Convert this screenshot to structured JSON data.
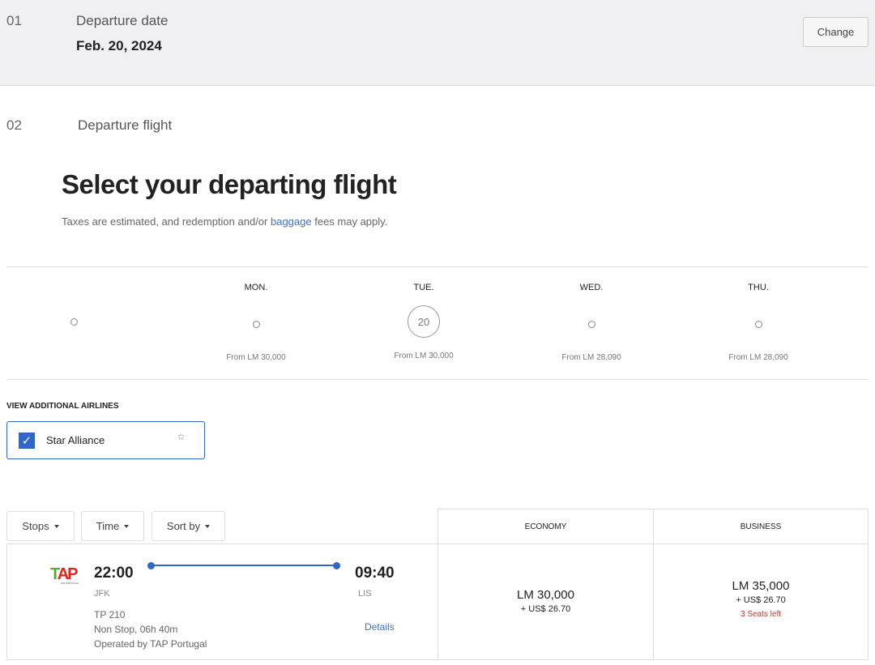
{
  "step1": {
    "num": "01",
    "label": "Departure date",
    "date": "Feb. 20, 2024",
    "change": "Change"
  },
  "step2": {
    "num": "02",
    "label": "Departure flight"
  },
  "title": "Select your departing flight",
  "subtitle": {
    "before": "Taxes are estimated, and redemption and/or ",
    "link": "baggage",
    "after": " fees may apply."
  },
  "days": [
    {
      "name": "MON.",
      "from": "From LM 30,000"
    },
    {
      "name": "TUE.",
      "date": "20",
      "from": "From LM 30,000",
      "selected": true
    },
    {
      "name": "WED.",
      "from": "From LM 28,090"
    },
    {
      "name": "THU.",
      "from": "From LM 28,090"
    }
  ],
  "airlines": {
    "heading": "VIEW ADDITIONAL AIRLINES",
    "option": "Star Alliance",
    "checked": true
  },
  "filters": {
    "stops": "Stops",
    "time": "Time",
    "sort": "Sort by"
  },
  "cabins": {
    "economy": "ECONOMY",
    "business": "BUSINESS"
  },
  "flight": {
    "logo": "TAP",
    "logo_sub": "AIR PORTUGAL",
    "dep_time": "22:00",
    "dep_airport": "JFK",
    "arr_time": "09:40",
    "arr_airport": "LIS",
    "number": "TP 210",
    "duration": "Non Stop, 06h 40m",
    "operator": "Operated by TAP Portugal",
    "details": "Details",
    "economy": {
      "miles": "LM 30,000",
      "tax": "+ US$ 26.70"
    },
    "business": {
      "miles": "LM 35,000",
      "tax": "+ US$ 26.70",
      "seats": "3 Seats left"
    }
  },
  "colors": {
    "accent": "#2f66c9",
    "seats": "#c0392b"
  }
}
